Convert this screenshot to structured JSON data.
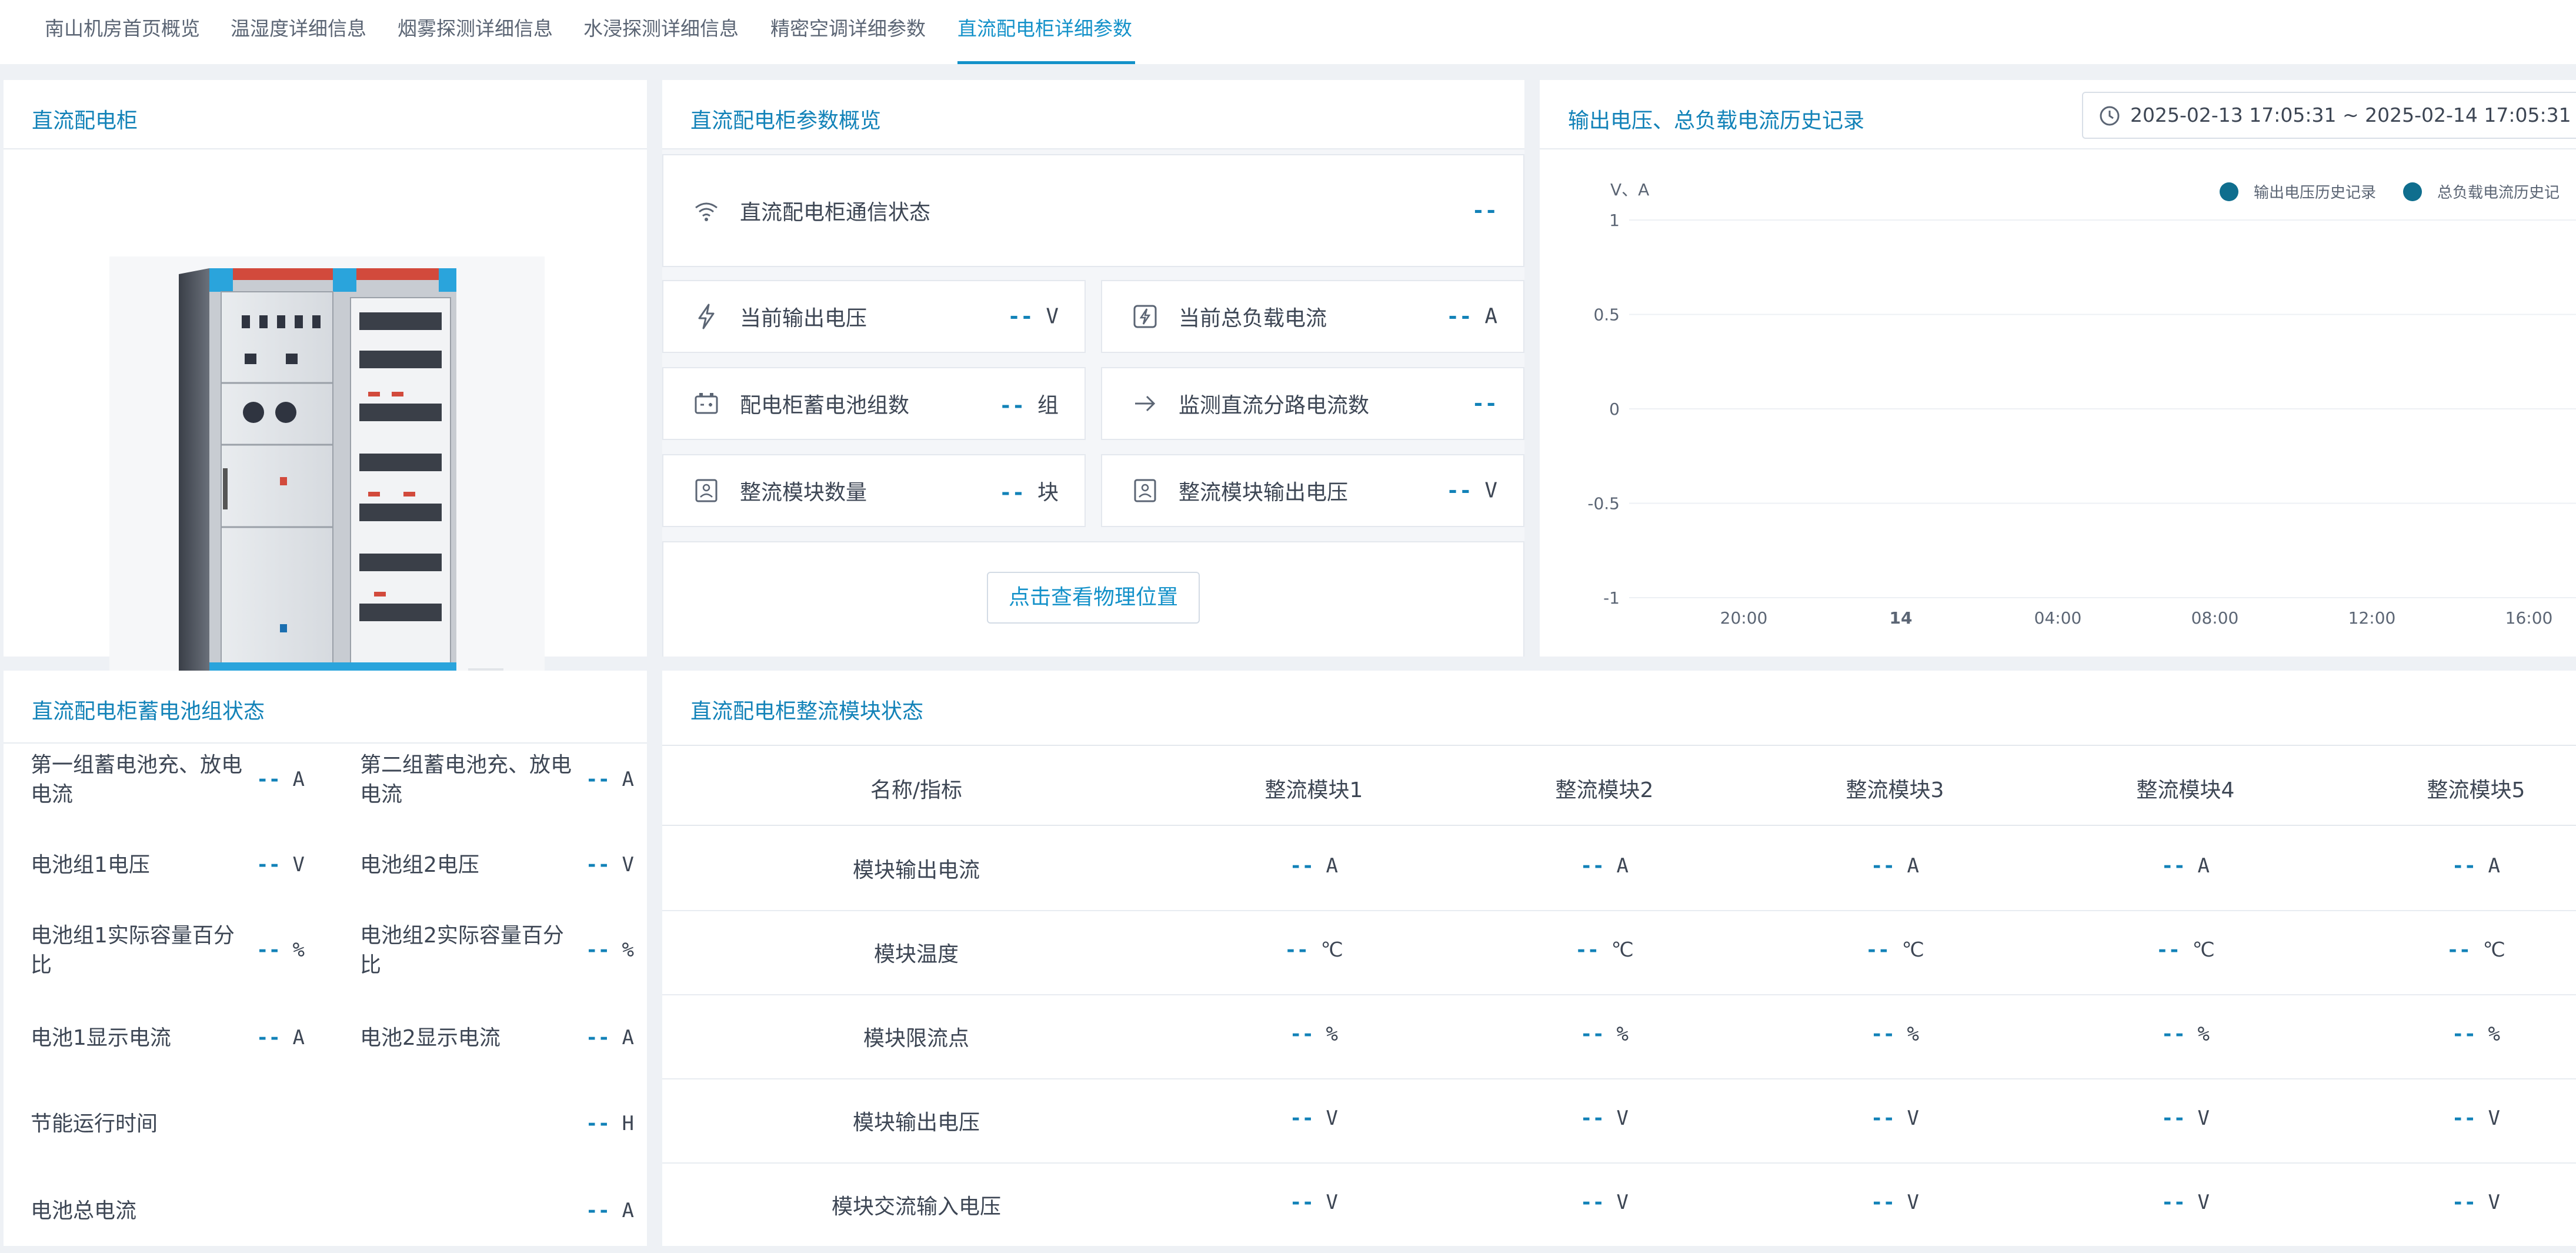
{
  "tabs": [
    {
      "label": "南山机房首页概览",
      "active": false
    },
    {
      "label": "温湿度详细信息",
      "active": false
    },
    {
      "label": "烟雾探测详细信息",
      "active": false
    },
    {
      "label": "水浸探测详细信息",
      "active": false
    },
    {
      "label": "精密空调详细参数",
      "active": false
    },
    {
      "label": "直流配电柜详细参数",
      "active": true
    }
  ],
  "cabinet_panel": {
    "title": "直流配电柜"
  },
  "overview": {
    "title": "直流配电柜参数概览",
    "comm_status": {
      "label": "直流配电柜通信状态",
      "value": "--",
      "icon": "wifi-icon"
    },
    "items": [
      {
        "label": "当前输出电压",
        "dash": "--",
        "unit": "V",
        "icon": "lightning-icon"
      },
      {
        "label": "当前总负载电流",
        "dash": "--",
        "unit": "A",
        "icon": "current-box-icon"
      },
      {
        "label": "配电柜蓄电池组数",
        "dash": "--",
        "unit": "组",
        "icon": "battery-icon"
      },
      {
        "label": "监测直流分路电流数",
        "dash": "--",
        "unit": "",
        "icon": "arrow-right-icon"
      },
      {
        "label": "整流模块数量",
        "dash": "--",
        "unit": "块",
        "icon": "module-icon"
      },
      {
        "label": "整流模块输出电压",
        "dash": "--",
        "unit": "V",
        "icon": "module-icon"
      }
    ],
    "location_button": "点击查看物理位置"
  },
  "history": {
    "title": "输出电压、总负载电流历史记录",
    "date_range": "2025-02-13 17:05:31  ~  2025-02-14 17:05:31"
  },
  "chart_data": {
    "type": "line",
    "title": "",
    "ylabel": "V、A",
    "xlabel": "",
    "ylim": [
      -1,
      1
    ],
    "yticks": [
      "1",
      "0.5",
      "0",
      "-0.5",
      "-1"
    ],
    "x": [
      "20:00",
      "14",
      "04:00",
      "08:00",
      "12:00",
      "16:00"
    ],
    "series": [
      {
        "name": "输出电压历史记录",
        "values": [],
        "color": "#0f6e8e"
      },
      {
        "name": "总负载电流历史记",
        "values": [],
        "color": "#0f6e8e"
      }
    ],
    "legend": "top-right",
    "grid": true
  },
  "battery": {
    "title": "直流配电柜蓄电池组状态",
    "rows": [
      {
        "left_label": "第一组蓄电池充、放电电流",
        "left_dash": "--",
        "left_unit": "A",
        "right_label": "第二组蓄电池充、放电电流",
        "right_dash": "--",
        "right_unit": "A"
      },
      {
        "left_label": "电池组1电压",
        "left_dash": "--",
        "left_unit": "V",
        "right_label": "电池组2电压",
        "right_dash": "--",
        "right_unit": "V"
      },
      {
        "left_label": "电池组1实际容量百分比",
        "left_dash": "--",
        "left_unit": "%",
        "right_label": "电池组2实际容量百分比",
        "right_dash": "--",
        "right_unit": "%"
      },
      {
        "left_label": "电池1显示电流",
        "left_dash": "--",
        "left_unit": "A",
        "right_label": "电池2显示电流",
        "right_dash": "--",
        "right_unit": "A"
      }
    ],
    "single_rows": [
      {
        "label": "节能运行时间",
        "dash": "--",
        "unit": "H"
      },
      {
        "label": "电池总电流",
        "dash": "--",
        "unit": "A"
      }
    ]
  },
  "rectifier": {
    "title": "直流配电柜整流模块状态",
    "columns": [
      "名称/指标",
      "整流模块1",
      "整流模块2",
      "整流模块3",
      "整流模块4",
      "整流模块5"
    ],
    "rows": [
      {
        "name": "模块输出电流",
        "dash": "--",
        "unit": "A"
      },
      {
        "name": "模块温度",
        "dash": "--",
        "unit": "℃"
      },
      {
        "name": "模块限流点",
        "dash": "--",
        "unit": "%"
      },
      {
        "name": "模块输出电压",
        "dash": "--",
        "unit": "V"
      },
      {
        "name": "模块交流输入电压",
        "dash": "--",
        "unit": "V"
      }
    ]
  }
}
